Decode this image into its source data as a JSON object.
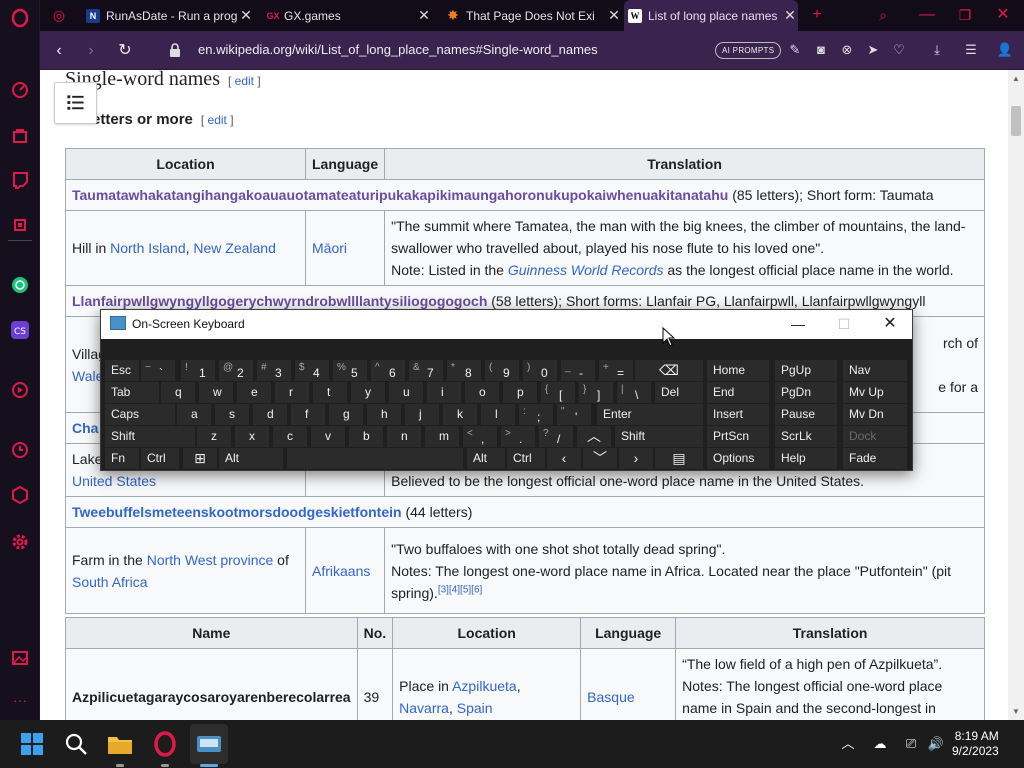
{
  "tabs": [
    {
      "title": "RunAsDate - Run a prog",
      "favicon": "N"
    },
    {
      "title": "GX.games",
      "favicon": "GX"
    },
    {
      "title": "That Page Does Not Exi",
      "favicon": "star"
    },
    {
      "title": "List of long place names",
      "favicon": "W"
    }
  ],
  "address": {
    "url": "en.wikipedia.org/wiki/List_of_long_place_names#Single-word_names",
    "ai_prompts": "AI PROMPTS"
  },
  "article": {
    "section_title": "Single-word names",
    "edit": "edit",
    "subsection_title": "Letters or more",
    "subsection_title_visible": "etters or more",
    "table1": {
      "headers": [
        "Location",
        "Language",
        "Translation"
      ],
      "entries": [
        {
          "name": "Taumatawhakatangihangakoauauotamateaturipukakapikimaungahoronukupokaiwhenuakitanatahu",
          "info": " (85 letters); Short form: Taumata",
          "loc_prefix": "Hill in ",
          "loc_link1": "North Island",
          "loc_sep": ", ",
          "loc_link2": "New Zealand",
          "lang": "Māori",
          "translation": "\"The summit where Tamatea, the man with the big knees, the climber of mountains, the land-swallower who travelled about, played his nose flute to his loved one\".",
          "note_prefix": "Note: Listed in the ",
          "note_link": "Guinness World Records",
          "note_suffix": " as the longest official place name in the world."
        },
        {
          "name": "Llanfairpwllgwyngyllgogerychwyrndrobwllllantysiliogogogoch",
          "info": " (58 letters); Short forms: Llanfair PG, Llanfairpwll, Llanfairpwllgwyngyll",
          "loc_partial1": "Villag",
          "loc_partial2": "Wale",
          "trans_partial1": "rch of",
          "trans_partial2": "e for a"
        },
        {
          "name_partial": "Cha",
          "loc_partial1": "Lake",
          "loc_link": "United States",
          "translation": "Believed to be the longest official one-word place name in the United States."
        },
        {
          "name": "Tweebuffelsmeteenskootmorsdoodgeskietfontein",
          "info": " (44 letters)",
          "loc_prefix": "Farm in the ",
          "loc_link1": "North West province",
          "loc_mid": " of",
          "loc_link2": "South Africa",
          "lang": "Afrikaans",
          "translation": "\"Two buffaloes with one shot shot totally dead spring\".",
          "note": "Notes: The longest one-word place name in Africa. Located near the place \"Putfontein\" (pit spring).",
          "refs": "[3][4][5][6]"
        }
      ]
    },
    "table2": {
      "headers": [
        "Name",
        "No.",
        "Location",
        "Language",
        "Translation"
      ],
      "row": {
        "name": "Azpilicuetagaraycosaroyarenberecolarrea",
        "no": "39",
        "loc_prefix": "Place in ",
        "loc_link1": "Azpilkueta",
        "loc_sep": ",",
        "loc_link2": "Navarra",
        "loc_sep2": ", ",
        "loc_link3": "Spain",
        "lang": "Basque",
        "translation": "“The low field of a high pen of Azpilkueta”.",
        "note": "Notes: The longest official one-word place name in Spain and the second-longest in Europe."
      }
    }
  },
  "osk": {
    "title": "On-Screen Keyboard",
    "rows": [
      [
        [
          "Esc",
          ""
        ],
        [
          "~",
          "`"
        ],
        [
          "!",
          "1"
        ],
        [
          "@",
          "2"
        ],
        [
          "#",
          "3"
        ],
        [
          "$",
          "4"
        ],
        [
          "%",
          "5"
        ],
        [
          "^",
          "6"
        ],
        [
          "&",
          "7"
        ],
        [
          "*",
          "8"
        ],
        [
          "(",
          "9"
        ],
        [
          ")",
          "0"
        ],
        [
          "_",
          "-"
        ],
        [
          "+",
          "="
        ],
        [
          "",
          ""
        ]
      ],
      [
        [
          "Tab",
          ""
        ],
        [
          "",
          "q"
        ],
        [
          "",
          "w"
        ],
        [
          "",
          "e"
        ],
        [
          "",
          "r"
        ],
        [
          "",
          "t"
        ],
        [
          "",
          "y"
        ],
        [
          "",
          "u"
        ],
        [
          "",
          "i"
        ],
        [
          "",
          "o"
        ],
        [
          "",
          "p"
        ],
        [
          "{",
          "["
        ],
        [
          "}",
          "]"
        ],
        [
          "|",
          "\\"
        ],
        [
          "Del",
          ""
        ]
      ],
      [
        [
          "Caps",
          ""
        ],
        [
          "",
          "a"
        ],
        [
          "",
          "s"
        ],
        [
          "",
          "d"
        ],
        [
          "",
          "f"
        ],
        [
          "",
          "g"
        ],
        [
          "",
          "h"
        ],
        [
          "",
          "j"
        ],
        [
          "",
          "k"
        ],
        [
          "",
          "l"
        ],
        [
          ":",
          ";"
        ],
        [
          "\"",
          "'"
        ],
        [
          "Enter",
          ""
        ]
      ],
      [
        [
          "Shift",
          ""
        ],
        [
          "",
          "z"
        ],
        [
          "",
          "x"
        ],
        [
          "",
          "c"
        ],
        [
          "",
          "v"
        ],
        [
          "",
          "b"
        ],
        [
          "",
          "n"
        ],
        [
          "",
          "m"
        ],
        [
          "<",
          ","
        ],
        [
          ">",
          "."
        ],
        [
          "?",
          "/"
        ],
        [
          "",
          ""
        ],
        [
          "Shift",
          ""
        ]
      ],
      [
        [
          "Fn",
          ""
        ],
        [
          "Ctrl",
          ""
        ],
        [
          "",
          ""
        ],
        [
          "Alt",
          ""
        ],
        [
          "",
          ""
        ],
        [
          "Alt",
          ""
        ],
        [
          "Ctrl",
          ""
        ],
        [
          "",
          ""
        ],
        [
          "",
          ""
        ],
        [
          "",
          ""
        ],
        [
          "",
          ""
        ]
      ]
    ],
    "side": [
      [
        "Home",
        "PgUp",
        "Nav"
      ],
      [
        "End",
        "PgDn",
        "Mv Up"
      ],
      [
        "Insert",
        "Pause",
        "Mv Dn"
      ],
      [
        "PrtScn",
        "ScrLk",
        "Dock"
      ],
      [
        "Options",
        "Help",
        "Fade"
      ]
    ]
  },
  "taskbar": {
    "time": "8:19 AM",
    "date": "9/2/2023"
  },
  "colors": {
    "opera_red": "#e0194a",
    "link": "#3366cc",
    "visited": "#6b4ba1",
    "tab_active": "#3b2350"
  }
}
